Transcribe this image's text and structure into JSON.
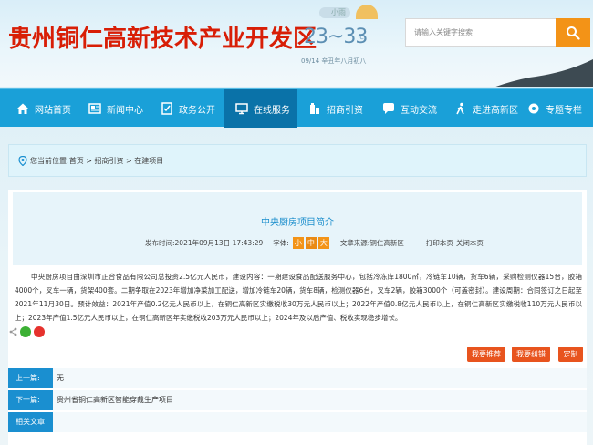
{
  "header": {
    "site_title": "贵州铜仁高新技术产业开发区",
    "weather": {
      "code": "小雨 ",
      "temp": "23~33",
      "unit": "℃",
      "date": "09/14 辛丑年八月初八"
    },
    "search": {
      "placeholder": "请输入关键字搜索"
    }
  },
  "nav": {
    "items": [
      {
        "label": "网站首页",
        "icon": "home-icon"
      },
      {
        "label": "新闻中心",
        "icon": "news-icon"
      },
      {
        "label": "政务公开",
        "icon": "document-icon"
      },
      {
        "label": "在线服务",
        "icon": "computer-icon",
        "active": true
      },
      {
        "label": "招商引资",
        "icon": "building-icon"
      },
      {
        "label": "互动交流",
        "icon": "chat-icon"
      },
      {
        "label": "走进高新区",
        "icon": "walk-icon"
      },
      {
        "label": "专题专栏",
        "icon": "gear-icon"
      }
    ]
  },
  "breadcrumb": {
    "prefix": "您当前位置:",
    "path": "首页 > 招商引资 > 在建项目"
  },
  "article": {
    "title": "中央厨房项目简介",
    "publish_label": "发布时间:",
    "publish_time": "2021年09月13日 17:43:29",
    "font_label": "字体:",
    "font_small": "小",
    "font_medium": "中",
    "font_large": "大",
    "source_label": "文章来源:",
    "source": "铜仁高新区",
    "print": "打印本页",
    "close": "关闭本页",
    "body": "中央厨房项目由深圳市正合食品有限公司总投资2.5亿元人民币，建设内容：一期建设食品配送服务中心，包括冷冻库1800㎡，冷链车10辆，货车6辆，采购检测仪器15台，胶箱4000个，叉车一辆，货架400套。二期争取在2023年增加净菜加工配送，增加冷链车20辆，货车8辆，检测仪器6台，叉车2辆，胶箱3000个（可盖密封）。建设周期：合同签订之日起至2021年11月30日。预计效益：2021年产值0.2亿元人民币以上，在铜仁高新区实缴税收30万元人民币以上；2022年产值0.8亿元人民币以上，在铜仁高新区实缴税收110万元人民币以上；2023年产值1.5亿元人民币以上，在铜仁高新区年实缴税收203万元人民币以上；2024年及以后产值、税收实现稳步增长。"
  },
  "actions": {
    "recommend": "我要推荐",
    "correct": "我要纠错",
    "subscribe": "定制"
  },
  "related": {
    "prev_label": "上一篇:",
    "prev_value": "无",
    "next_label": "下一篇:",
    "next_value": "贵州省铜仁高新区智能穿戴生产项目",
    "related_label": "相关文章"
  }
}
